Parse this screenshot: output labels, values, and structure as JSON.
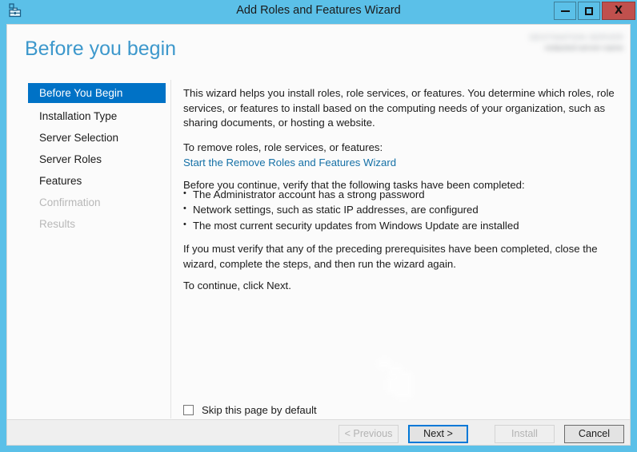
{
  "window": {
    "title": "Add Roles and Features Wizard",
    "icon": "server-manager-toolbox-icon",
    "controls": {
      "minimize_label": "Minimize",
      "maximize_label": "Maximize",
      "close_label": "X"
    },
    "colors": {
      "frame": "#5bc0e8",
      "close_button": "#c0504d",
      "accent_blue": "#0072c6",
      "focus_blue": "#0078d7",
      "link_blue": "#1570a6",
      "heading_blue": "#3d98cc"
    }
  },
  "header": {
    "page_title": "Before you begin",
    "destination_server_label": "DESTINATION SERVER",
    "destination_server_value": "redacted-server-name"
  },
  "sidebar": {
    "items": [
      {
        "label": "Before You Begin",
        "state": "selected"
      },
      {
        "label": "Installation Type",
        "state": "enabled"
      },
      {
        "label": "Server Selection",
        "state": "enabled"
      },
      {
        "label": "Server Roles",
        "state": "enabled"
      },
      {
        "label": "Features",
        "state": "enabled"
      },
      {
        "label": "Confirmation",
        "state": "disabled"
      },
      {
        "label": "Results",
        "state": "disabled"
      }
    ]
  },
  "content": {
    "intro_paragraph": "This wizard helps you install roles, role services, or features. You determine which roles, role services, or features to install based on the computing needs of your organization, such as sharing documents, or hosting a website.",
    "remove_prompt": "To remove roles, role services, or features:",
    "remove_link": "Start the Remove Roles and Features Wizard",
    "verify_prompt": "Before you continue, verify that the following tasks have been completed:",
    "tasks": [
      "The Administrator account has a strong password",
      "Network settings, such as static IP addresses, are configured",
      "The most current security updates from Windows Update are installed"
    ],
    "prerequisites_paragraph": "If you must verify that any of the preceding prerequisites have been completed, close the wizard, complete the steps, and then run the wizard again.",
    "continue_paragraph": "To continue, click Next.",
    "skip_checkbox_label": "Skip this page by default",
    "skip_checkbox_checked": false
  },
  "footer": {
    "buttons": [
      {
        "label": "< Previous",
        "state": "disabled"
      },
      {
        "label": "Next >",
        "state": "focused"
      },
      {
        "label": "Install",
        "state": "disabled"
      },
      {
        "label": "Cancel",
        "state": "enabled"
      }
    ]
  }
}
